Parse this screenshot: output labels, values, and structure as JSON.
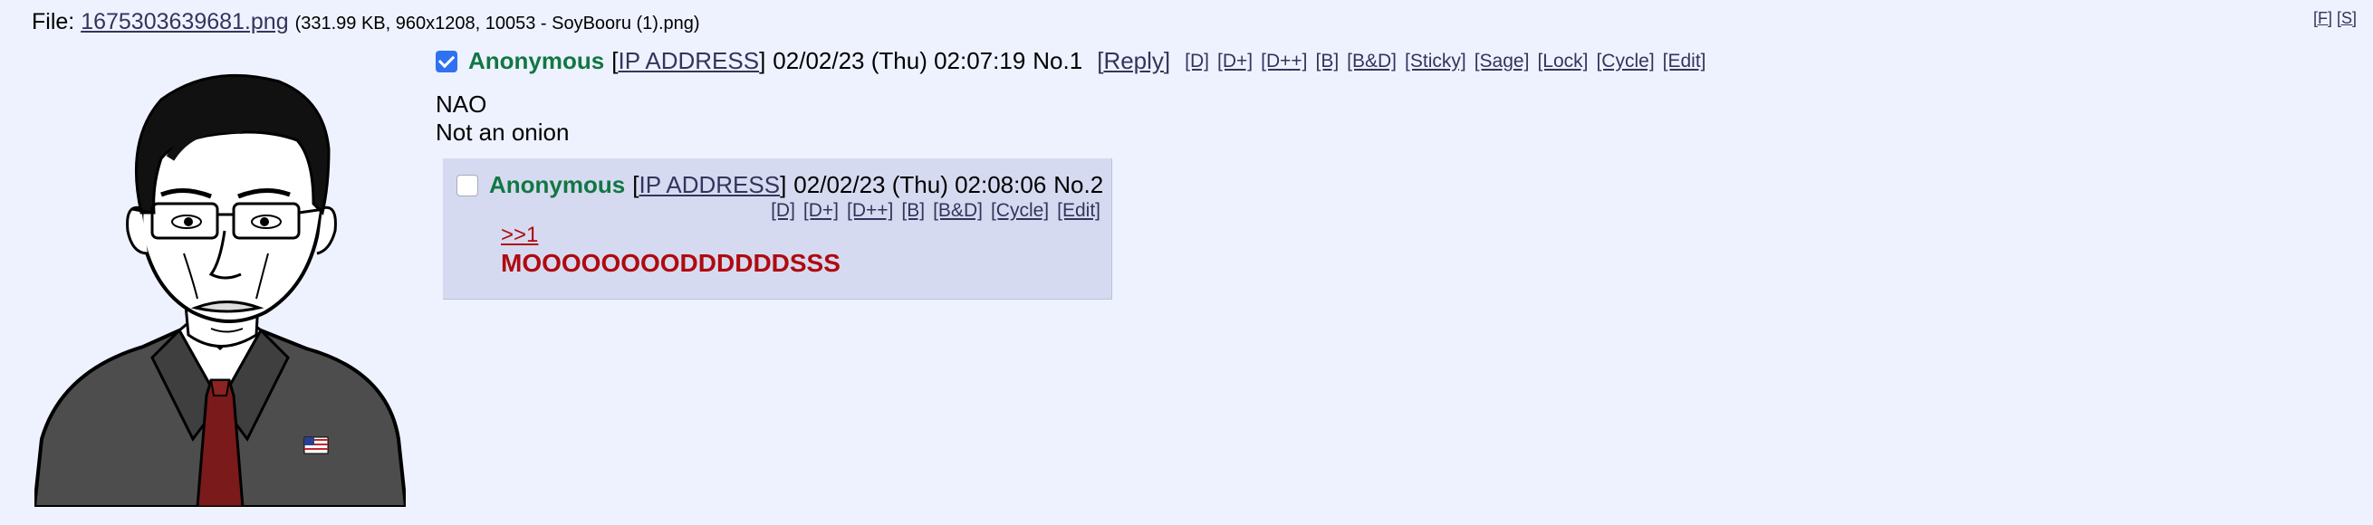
{
  "file": {
    "prefix": "File:",
    "name": "1675303639681.png",
    "info": "(331.99 KB, 960x1208, 10053 - SoyBooru (1).png)"
  },
  "corner_links": [
    "[F]",
    "[S]"
  ],
  "op": {
    "checked": true,
    "name": "Anonymous",
    "ip_open": "[",
    "ip": "IP ADDRESS",
    "ip_close": "]",
    "datetime": "02/02/23 (Thu) 02:07:19",
    "number": "No.1",
    "reply_open": "[",
    "reply": "Reply",
    "reply_close": "]",
    "mod_links": [
      "[D]",
      "[D+]",
      "[D++]",
      "[B]",
      "[B&D]",
      "[Sticky]",
      "[Sage]",
      "[Lock]",
      "[Cycle]",
      "[Edit]"
    ],
    "body": [
      "NAO",
      "Not an onion"
    ]
  },
  "reply": {
    "checked": false,
    "name": "Anonymous",
    "ip_open": "[",
    "ip": "IP ADDRESS",
    "ip_close": "]",
    "datetime": "02/02/23 (Thu) 02:08:06",
    "number": "No.2",
    "mod_links": [
      "[D]",
      "[D+]",
      "[D++]",
      "[B]",
      "[B&D]",
      "[Cycle]",
      "[Edit]"
    ],
    "quote": ">>1",
    "text": "MOOOOOOOODDDDDDSSS"
  },
  "colors": {
    "background": "#eef2ff",
    "reply_bg": "#d6daf0",
    "name": "#117743",
    "link": "#34345c",
    "quote": "#af0a0f"
  }
}
